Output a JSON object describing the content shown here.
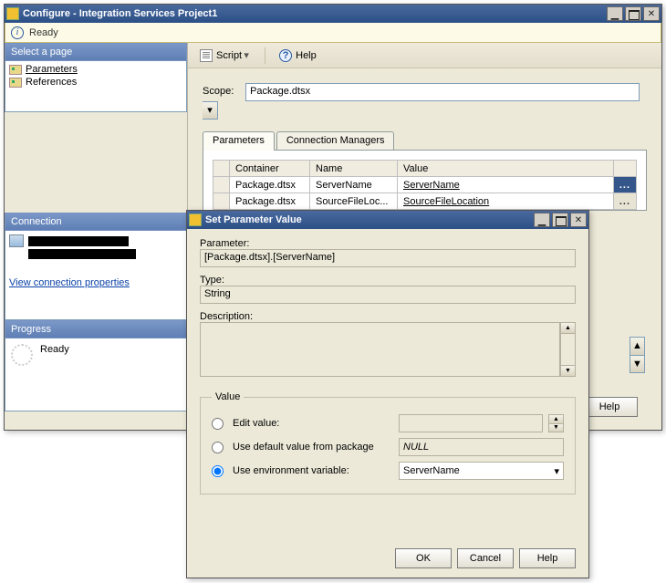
{
  "win1": {
    "title": "Configure - Integration Services Project1",
    "ready": "Ready",
    "side_hdr_page": "Select a page",
    "side_items": [
      "Parameters",
      "References"
    ],
    "side_hdr_conn": "Connection",
    "conn_link": "View connection properties",
    "side_hdr_prog": "Progress",
    "prog_text": "Ready",
    "toolbar": {
      "script": "Script",
      "help": "Help"
    },
    "scope_label": "Scope:",
    "scope_value": "Package.dtsx",
    "tabs": [
      "Parameters",
      "Connection Managers"
    ],
    "grid_headers": [
      "Container",
      "Name",
      "Value"
    ],
    "grid_rows": [
      {
        "container": "Package.dtsx",
        "name": "ServerName",
        "value": "ServerName",
        "dots": "..."
      },
      {
        "container": "Package.dtsx",
        "name": "SourceFileLoc...",
        "value": "SourceFileLocation",
        "dots": "..."
      }
    ],
    "help_btn": "Help"
  },
  "win2": {
    "title": "Set Parameter Value",
    "param_label": "Parameter:",
    "param_value": "[Package.dtsx].[ServerName]",
    "type_label": "Type:",
    "type_value": "String",
    "desc_label": "Description:",
    "value_legend": "Value",
    "opt_edit": "Edit value:",
    "opt_default": "Use default value from package",
    "default_value": "NULL",
    "opt_env": "Use environment variable:",
    "env_value": "ServerName",
    "buttons": {
      "ok": "OK",
      "cancel": "Cancel",
      "help": "Help"
    }
  }
}
